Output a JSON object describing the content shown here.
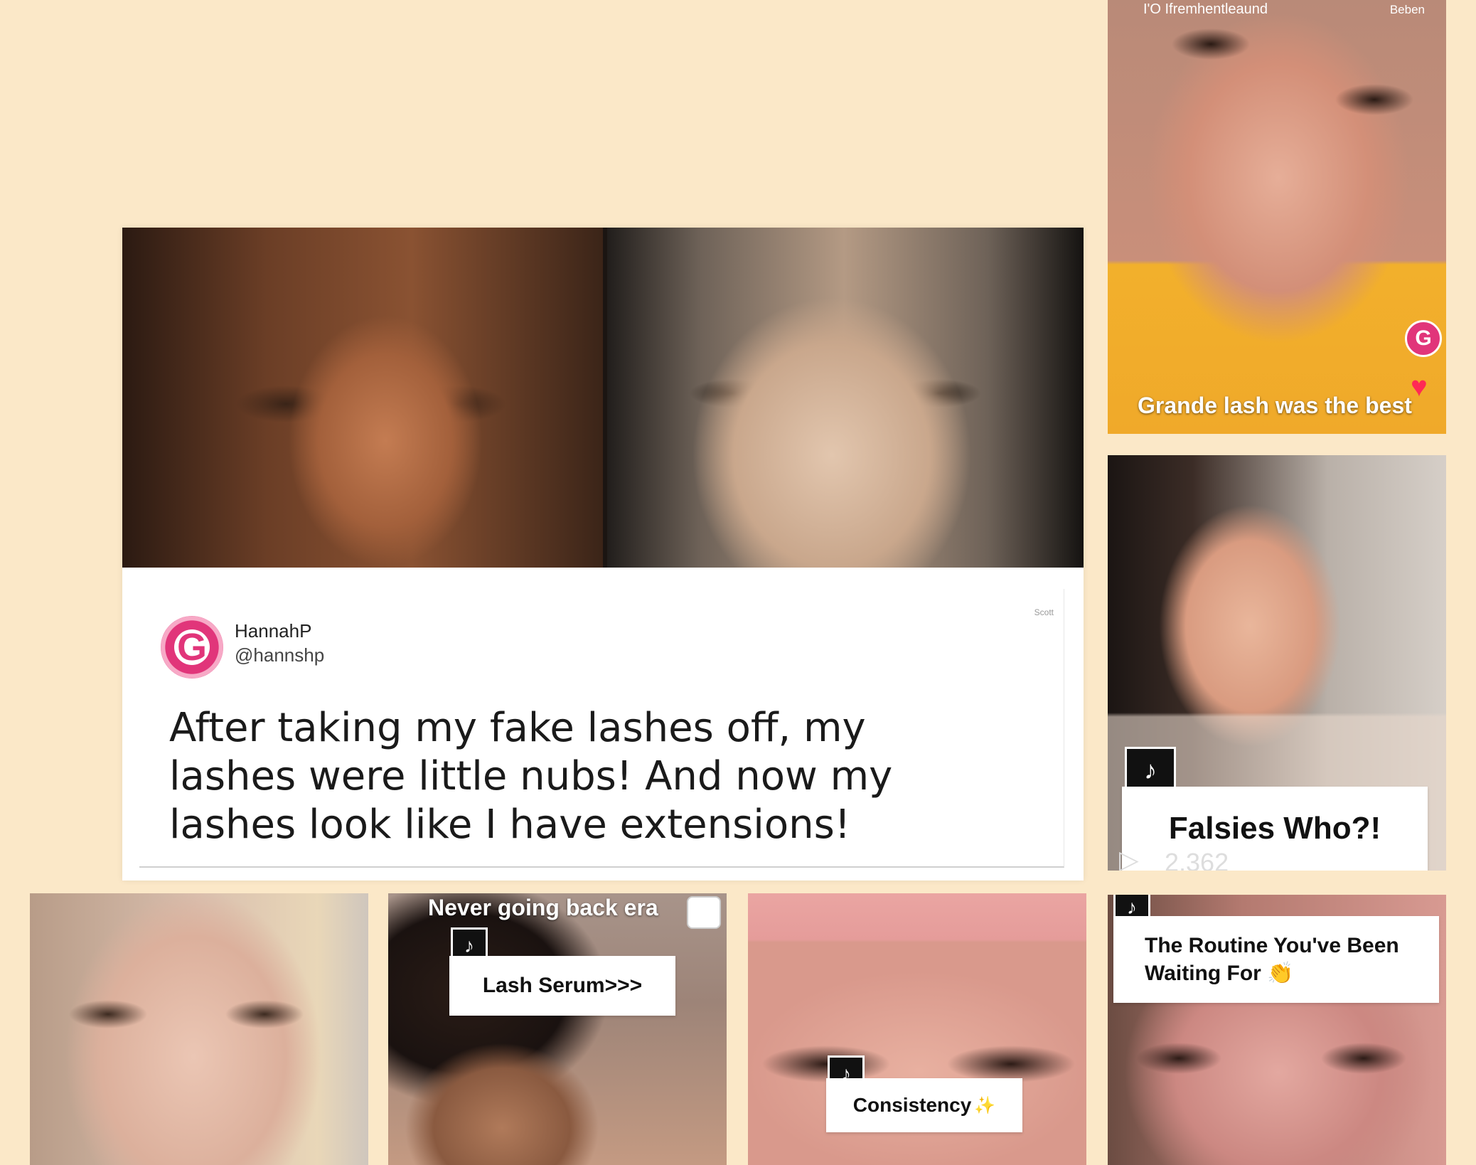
{
  "review": {
    "user_name": "HannahP",
    "user_handle": "@hannshp",
    "logo_letter": "G",
    "corner_tag": "Scott",
    "quote": "After taking my fake lashes off, my lashes were little nubs! And now my lashes look like I have extensions!"
  },
  "top_right_tile": {
    "header": "I'O  Ifremhentleaund",
    "header_right": "Beben",
    "back_icon": "‹",
    "logo_letter": "G",
    "caption": "Grande lash was the best"
  },
  "mid_right_tile": {
    "caption": "Falsies Who?!",
    "views": "2,362"
  },
  "bottom_tiles": [
    {
      "title": "Never going back era",
      "caption": "Lash Serum>>>"
    },
    {
      "caption": "Consistency"
    },
    {
      "caption_line1": "The Routine You've Been",
      "caption_line2": "Waiting For"
    }
  ],
  "icons": {
    "tiktok": "♪",
    "heart": "♥",
    "sparkle": "✨",
    "clap": "👏",
    "play": "▷"
  }
}
